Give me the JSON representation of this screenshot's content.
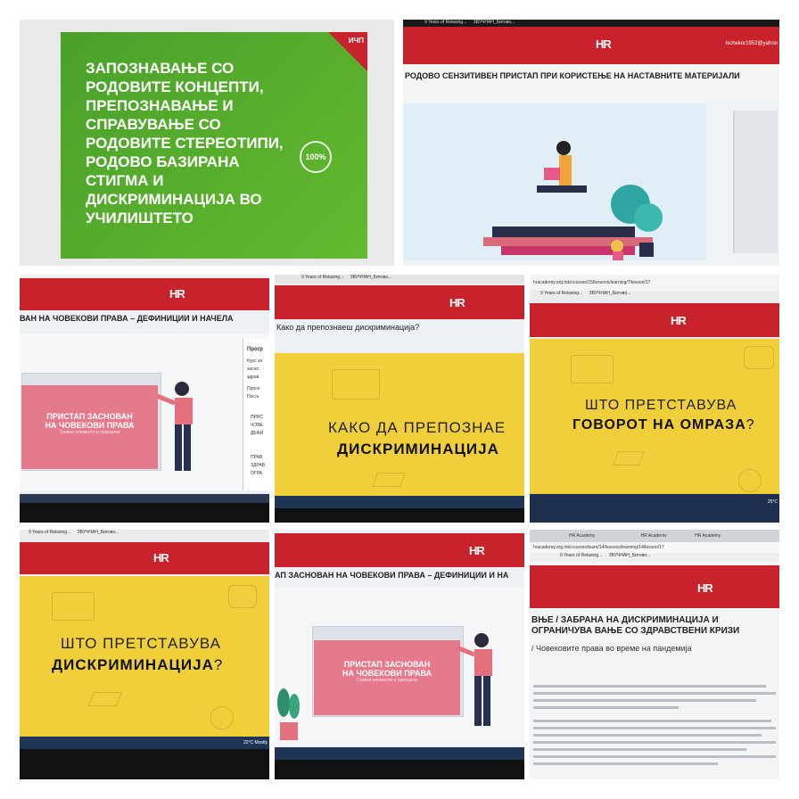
{
  "tile1": {
    "title": "ЗАПОЗНАВАЊЕ СО РОДОВИТЕ КОНЦЕПТИ, ПРЕПОЗНАВАЊЕ И СПРАВУВАЊЕ СО РОДОВИТЕ СТЕРЕОТИПИ, РОДОВО БАЗИРАНА СТИГМА И ДИСКРИМИНАЦИЈА ВО УЧИЛИШТЕТО",
    "corner_tag": "ИЧП",
    "progress": "100%"
  },
  "tile2": {
    "tab1": "9 Years of Relaxing...",
    "tab2": "ЗВУЧНАН_Битово...",
    "logo": "HR",
    "user": "Ischekor1952@yahoo",
    "title": "РОДОВО СЕНЗИТИВЕН ПРИСТАП ПРИ КОРИСТЕЊЕ НА НАСТАВНИТЕ МАТЕРИЈАЛИ"
  },
  "tile3": {
    "logo": "HR",
    "title": "ВАН НА ЧОВЕКОВИ ПРАВА – ДЕФИНИЦИИ И НАЧЕЛА",
    "box_line1": "ПРИСТАП ЗАСНОВАН",
    "box_line2": "НА ЧОВЕКОВИ ПРАВА",
    "box_line3": "Главни елементи и принципи",
    "side_head": "Прогр",
    "side_1": "Курс за",
    "side_2": "засно",
    "side_3": "здрав",
    "side_4": "Просе",
    "side_5": "Посљ",
    "side_6": "ПРИС",
    "side_7": "ЧОВЕ",
    "side_8": "ДЕФИ",
    "side_9": "ПРАВ",
    "side_10": "ЗДРАВ",
    "side_11": "ОГРА"
  },
  "tile4": {
    "tab1": "9 Years of Relaxing...",
    "tab2": "ЗВУЧНАН_Битово...",
    "logo": "HR",
    "question": "Како да препознаеш дискриминација?",
    "line1": "КАКО ДА ПРЕПОЗНАЕ",
    "line2": "ДИСКРИМИНАЦИЈА"
  },
  "tile5": {
    "url": "hracademy.org.mk/courses/15/lessons/learning/7/lesson/17",
    "tab1": "9 Years of Relaxing...",
    "tab2": "ЗВУЧНАН_Битово...",
    "logo": "HR",
    "line1": "ШТО ПРЕТСТАВУВА",
    "line2": "ГОВОРОТ НА ОМРАЗА",
    "q": "?",
    "temp": "25°C"
  },
  "tile6": {
    "tab1": "9 Years of Relaxing...",
    "tab2": "ЗВУЧНАН_Битово...",
    "logo": "HR",
    "line1": "ШТО ПРЕТСТАВУВА",
    "line2": "ДИСКРИМИНАЦИЈА",
    "q": "?",
    "status": "22°C Mostly"
  },
  "tile7": {
    "logo": "HR",
    "title": "АП ЗАСНОВАН НА ЧОВЕКОВИ ПРАВА – ДЕФИНИЦИИ И НА",
    "box_line1": "ПРИСТАП ЗАСНОВАН",
    "box_line2": "НА ЧОВЕКОВИ ПРАВА",
    "box_line3": "Главни елементи и принципи"
  },
  "tile8": {
    "tab1": "HR Academy",
    "tab2": "HR Academy",
    "tab3": "HR Academy",
    "url": "hracademy.org.mk/courses/learn/14/lessons/learning/14/lesson/17",
    "bookmark1": "9 Years of Relaxing...",
    "bookmark2": "ЗВУЧНАН_Битово...",
    "logo": "HR",
    "title": "ВЊЕ / ЗАБРАНА НА ДИСКРИМИНАЦИЈА И ОГРАНИЧУВА ВАЊЕ СО ЗДРАВСТВЕНИ КРИЗИ",
    "subtitle": "/ Човековите права во време на пандемија"
  },
  "colors": {
    "red": "#c8232c",
    "green": "#4fa827",
    "yellow": "#f0cf3a",
    "pink": "#e57a8c"
  }
}
